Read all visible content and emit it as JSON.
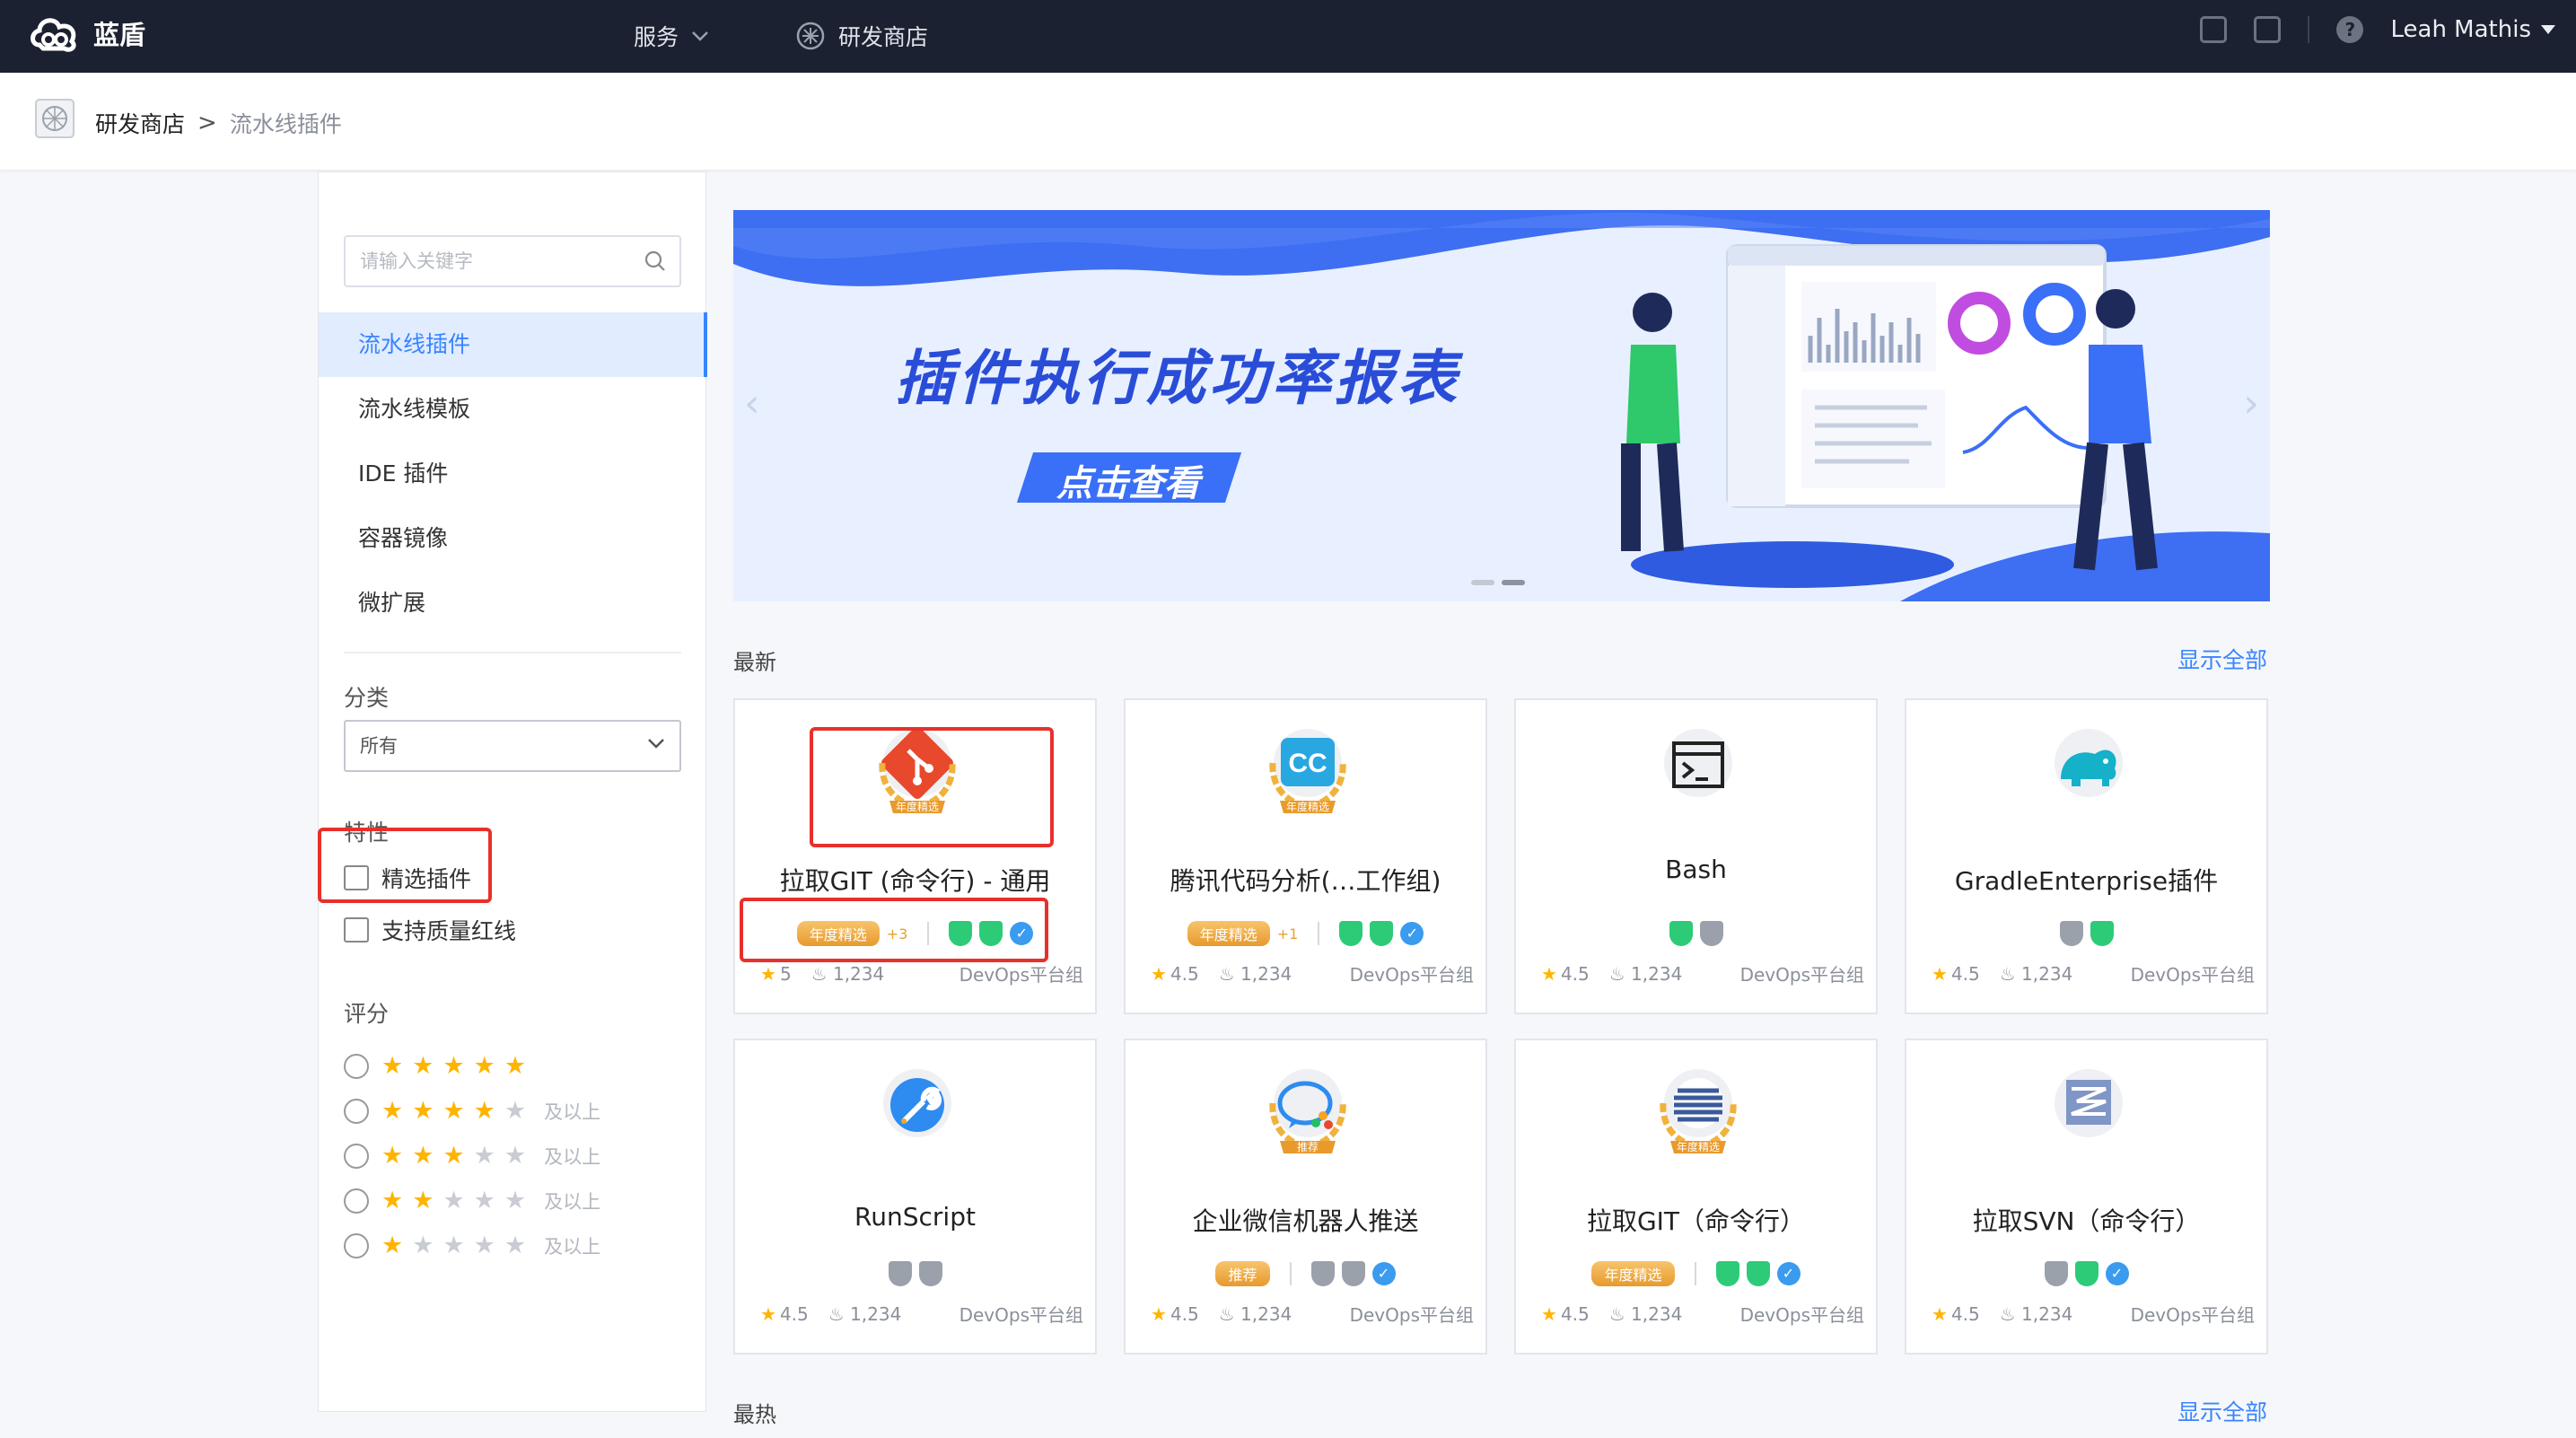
{
  "topbar": {
    "app_name": "蓝盾",
    "nav": [
      {
        "label": "服务"
      },
      {
        "label": "研发商店"
      }
    ],
    "user": "Leah Mathis"
  },
  "breadcrumb": {
    "store": "研发商店",
    "separator": ">",
    "current": "流水线插件"
  },
  "sidebar": {
    "search_placeholder": "请输入关键字",
    "menu": [
      {
        "label": "流水线插件",
        "active": true
      },
      {
        "label": "流水线模板"
      },
      {
        "label": "IDE 插件"
      },
      {
        "label": "容器镜像"
      },
      {
        "label": "微扩展"
      }
    ],
    "category_label": "分类",
    "category_value": "所有",
    "feature_label": "特性",
    "features": [
      {
        "label": "精选插件"
      },
      {
        "label": "支持质量红线"
      }
    ],
    "rating_label": "评分",
    "ratings": [
      {
        "stars": 5,
        "suffix": ""
      },
      {
        "stars": 4,
        "suffix": "及以上"
      },
      {
        "stars": 3,
        "suffix": "及以上"
      },
      {
        "stars": 2,
        "suffix": "及以上"
      },
      {
        "stars": 1,
        "suffix": "及以上"
      }
    ]
  },
  "banner": {
    "title": "插件执行成功率报表",
    "button": "点击查看"
  },
  "sections": [
    {
      "title": "最新",
      "show_all": "显示全部"
    },
    {
      "title": "最热",
      "show_all": "显示全部"
    }
  ],
  "cards": [
    {
      "name": "拉取GIT (命令行) - 通用",
      "ribbon": "年度精选",
      "plus": "+3",
      "badges": [
        "shield-green",
        "sla-green",
        "verify"
      ],
      "rating": "5",
      "hot": "1,234",
      "owner": "DevOps平台组",
      "icon_badge": "年度精选",
      "icon": "git"
    },
    {
      "name": "腾讯代码分析(…工作组)",
      "ribbon": "年度精选",
      "plus": "+1",
      "badges": [
        "shield-green",
        "sla-green",
        "verify"
      ],
      "rating": "4.5",
      "hot": "1,234",
      "owner": "DevOps平台组",
      "icon_badge": "年度精选",
      "icon": "cc"
    },
    {
      "name": "Bash",
      "ribbon": "",
      "plus": "",
      "badges": [
        "shield-green",
        "sla-gray"
      ],
      "rating": "4.5",
      "hot": "1,234",
      "owner": "DevOps平台组",
      "icon_badge": "",
      "icon": "terminal"
    },
    {
      "name": "GradleEnterprise插件",
      "ribbon": "",
      "plus": "",
      "badges": [
        "shield-gray",
        "sla-green"
      ],
      "rating": "4.5",
      "hot": "1,234",
      "owner": "DevOps平台组",
      "icon_badge": "",
      "icon": "elephant"
    },
    {
      "name": "RunScript",
      "ribbon": "",
      "plus": "",
      "badges": [
        "shield-gray",
        "sla-gray"
      ],
      "rating": "4.5",
      "hot": "1,234",
      "owner": "DevOps平台组",
      "icon_badge": "",
      "icon": "wrench"
    },
    {
      "name": "企业微信机器人推送",
      "ribbon": "推荐",
      "plus": "",
      "badges": [
        "shield-gray",
        "sla-gray",
        "verify"
      ],
      "rating": "4.5",
      "hot": "1,234",
      "owner": "DevOps平台组",
      "icon_badge": "推荐",
      "icon": "wechat"
    },
    {
      "name": "拉取GIT（命令行）",
      "ribbon": "年度精选",
      "plus": "",
      "badges": [
        "shield-green",
        "sla-green",
        "verify"
      ],
      "rating": "4.5",
      "hot": "1,234",
      "owner": "DevOps平台组",
      "icon_badge": "年度精选",
      "icon": "stripes"
    },
    {
      "name": "拉取SVN（命令行）",
      "ribbon": "",
      "plus": "",
      "badges": [
        "shield-gray",
        "sla-green",
        "verify"
      ],
      "rating": "4.5",
      "hot": "1,234",
      "owner": "DevOps平台组",
      "icon_badge": "",
      "icon": "svn"
    }
  ],
  "colors": {
    "topbar": "#1b2130",
    "accent": "#3a84ff",
    "banner_title": "#2a4dd8",
    "star": "#ffb400",
    "highlight": "#e8302b"
  }
}
